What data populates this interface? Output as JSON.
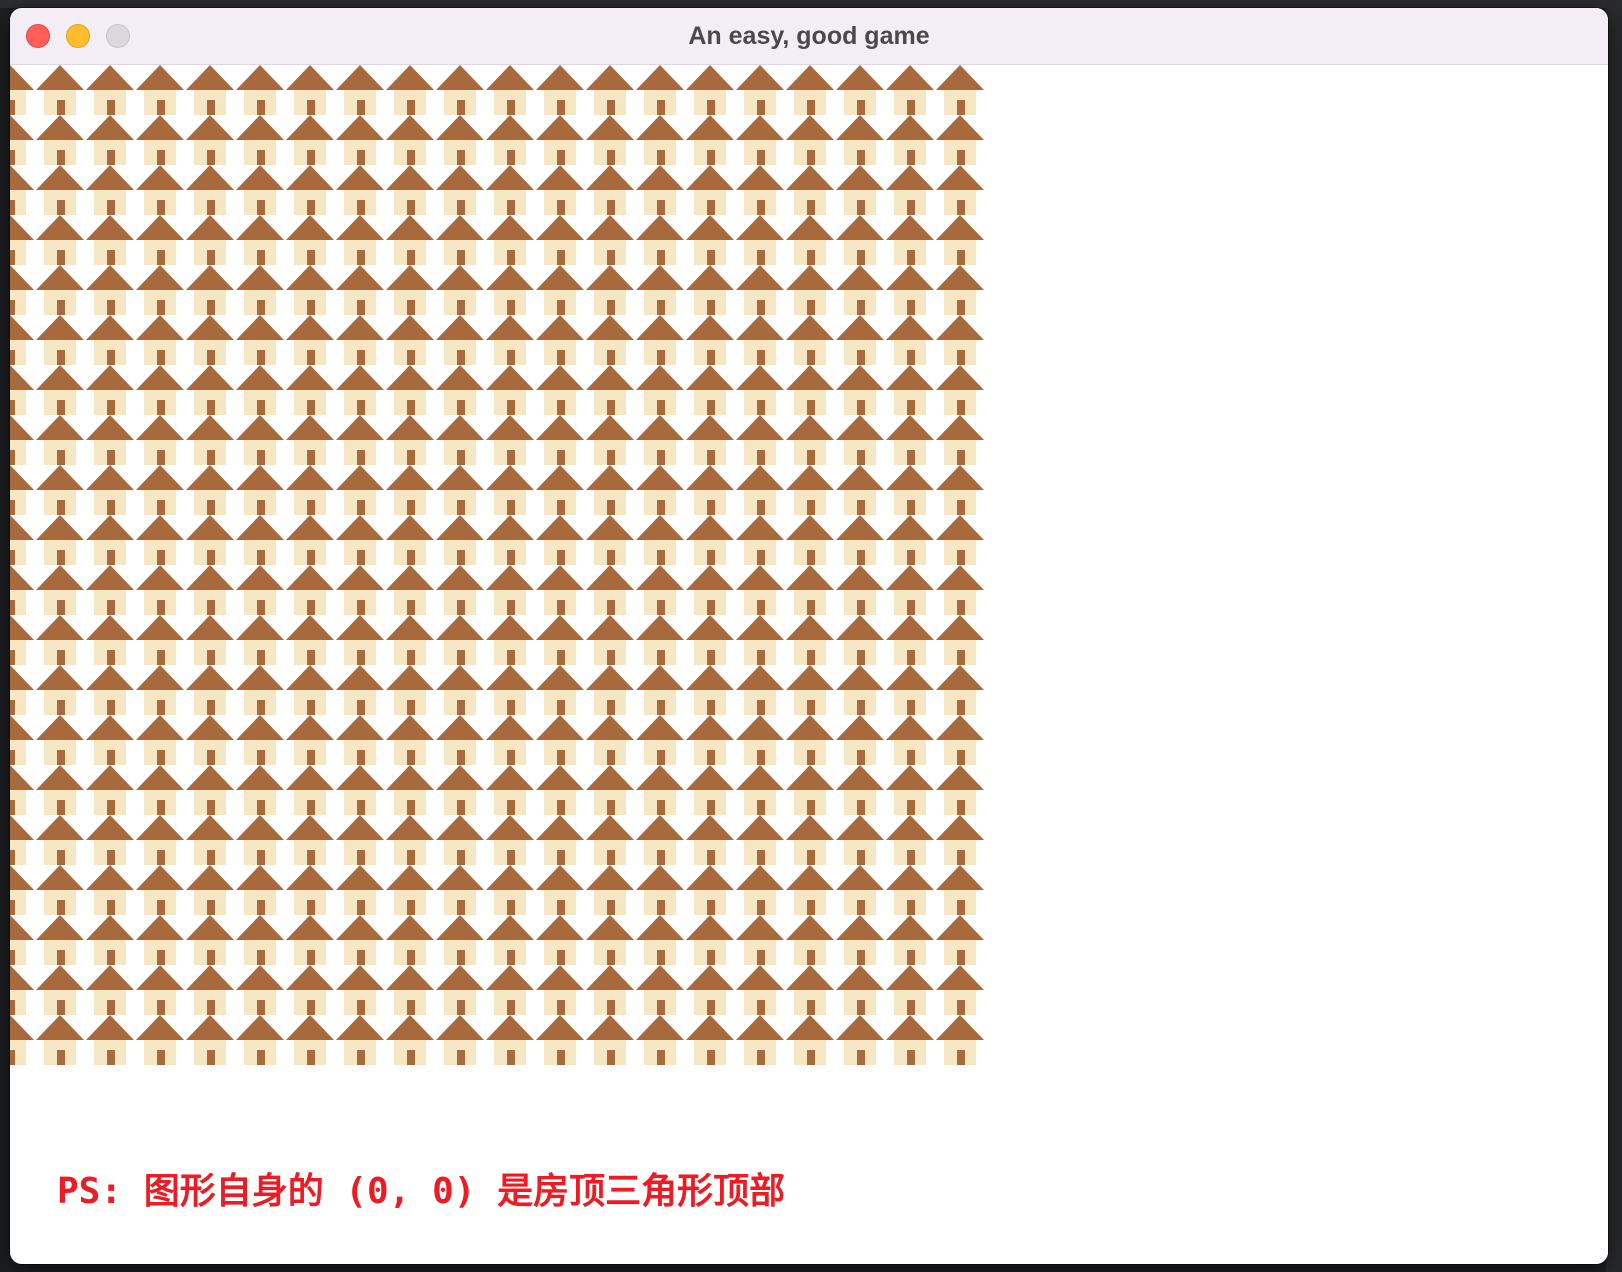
{
  "window": {
    "title": "An easy, good game",
    "controls": [
      "close",
      "minimize",
      "zoom"
    ]
  },
  "canvas": {
    "caption": "PS: 图形自身的 (0, 0) 是房顶三角形顶部",
    "caption_color": "#ed1c24",
    "house_grid": {
      "columns": 20,
      "rows": 20,
      "roof_color": "#a86a3d",
      "wall_color": "#f5e6c4",
      "door_color": "#a86a3d",
      "background": "#ffffff"
    }
  }
}
